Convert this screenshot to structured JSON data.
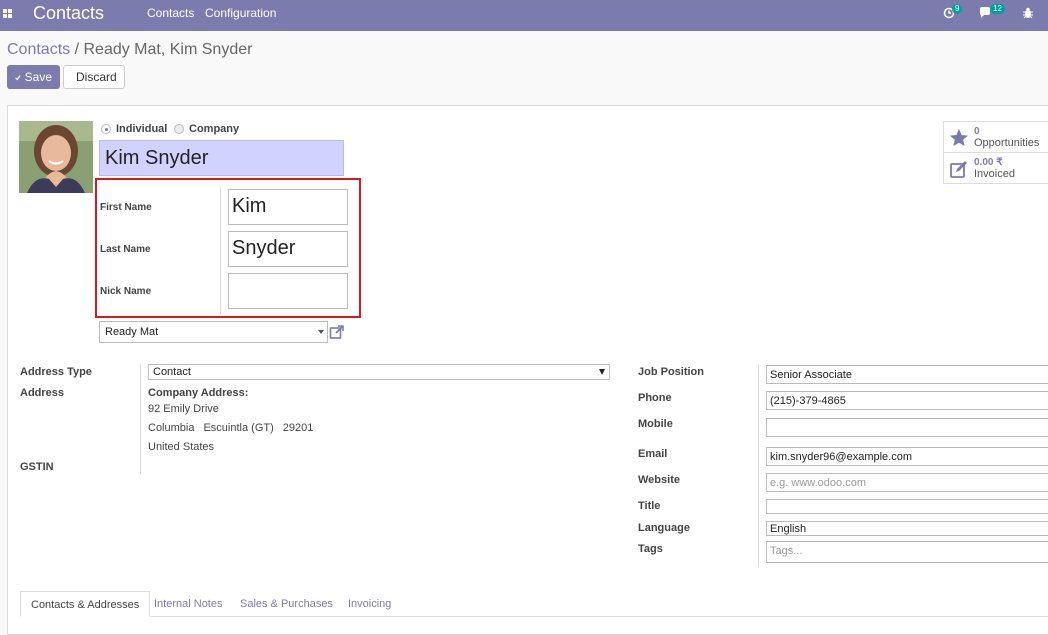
{
  "topbar": {
    "brand": "Contacts",
    "menu": [
      "Contacts",
      "Configuration"
    ],
    "activity_count": "9",
    "messages_count": "12"
  },
  "breadcrumb": {
    "parent": "Contacts",
    "separator": " / ",
    "current": "Ready Mat, Kim Snyder"
  },
  "actions": {
    "save": "Save",
    "discard": "Discard"
  },
  "company_type": {
    "individual": "Individual",
    "company": "Company",
    "selected": "individual"
  },
  "display_name": "Kim Snyder",
  "name_fields": {
    "first_name_label": "First Name",
    "first_name": "Kim",
    "last_name_label": "Last Name",
    "last_name": "Snyder",
    "nick_name_label": "Nick Name",
    "nick_name": ""
  },
  "parent_company": "Ready Mat",
  "smart_buttons": [
    {
      "value": "0",
      "label": "Opportunities",
      "icon": "star-icon"
    },
    {
      "value": "0.00 ₹",
      "label": "Invoiced",
      "icon": "pencil-square-icon"
    }
  ],
  "left_fields": {
    "address_type_label": "Address Type",
    "address_type": "Contact",
    "address_label": "Address",
    "company_address_heading": "Company Address:",
    "street": "92 Emily Drive",
    "city": "Columbia",
    "state": "Escuintla (GT)",
    "zip": "29201",
    "country": "United States",
    "gstin_label": "GSTIN"
  },
  "right_fields": {
    "job_position_label": "Job Position",
    "job_position": "Senior Associate",
    "phone_label": "Phone",
    "phone": "(215)-379-4865",
    "mobile_label": "Mobile",
    "mobile": "",
    "email_label": "Email",
    "email": "kim.snyder96@example.com",
    "website_label": "Website",
    "website_placeholder": "e.g. www.odoo.com",
    "title_label": "Title",
    "title": "",
    "language_label": "Language",
    "language": "English",
    "tags_label": "Tags",
    "tags_placeholder": "Tags..."
  },
  "tabs": [
    "Contacts & Addresses",
    "Internal Notes",
    "Sales & Purchases",
    "Invoicing"
  ],
  "colors": {
    "brand": "#7c7bad",
    "highlight": "#d9181f",
    "name_bg": "#d2d2ff"
  }
}
